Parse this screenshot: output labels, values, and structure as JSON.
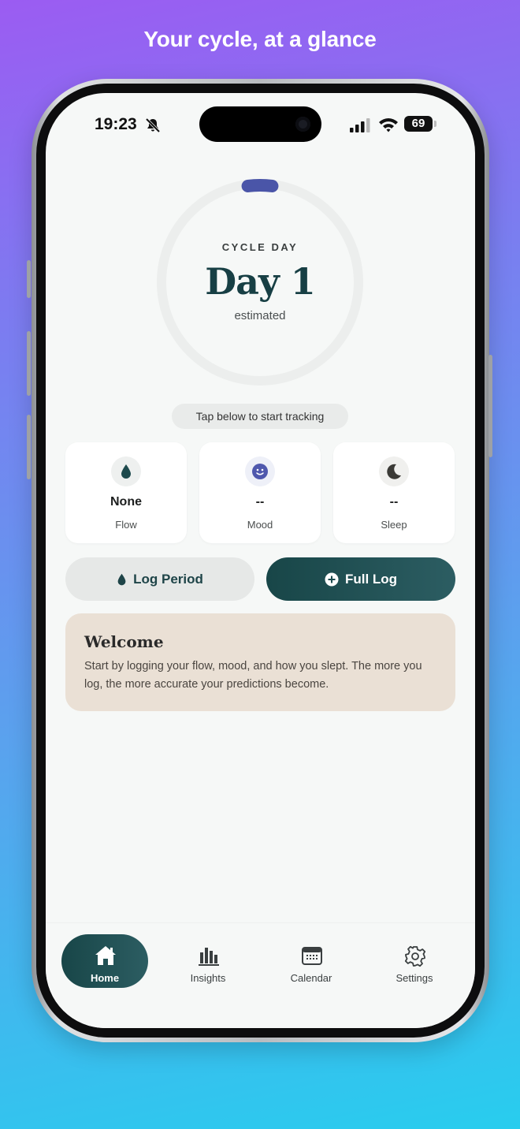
{
  "headline": "Your cycle, at a glance",
  "status_bar": {
    "time": "19:23",
    "battery": "69",
    "icons": [
      "bell-slash-icon",
      "signal-icon",
      "wifi-icon",
      "battery-icon"
    ]
  },
  "cycle": {
    "label": "CYCLE DAY",
    "day": "Day 1",
    "note": "estimated",
    "progress_fraction": 0.04
  },
  "tip": "Tap below to start tracking",
  "stats": [
    {
      "icon": "drop-icon",
      "value": "None",
      "label": "Flow"
    },
    {
      "icon": "smile-icon",
      "value": "--",
      "label": "Mood"
    },
    {
      "icon": "moon-icon",
      "value": "--",
      "label": "Sleep"
    }
  ],
  "actions": {
    "log_period": "Log Period",
    "full_log": "Full Log"
  },
  "welcome": {
    "title": "Welcome",
    "body": "Start by logging your flow, mood, and how you slept. The more you log, the more accurate your predictions become."
  },
  "tabs": [
    {
      "label": "Home",
      "icon": "home-icon",
      "active": true
    },
    {
      "label": "Insights",
      "icon": "bar-chart-icon",
      "active": false
    },
    {
      "label": "Calendar",
      "icon": "calendar-icon",
      "active": false
    },
    {
      "label": "Settings",
      "icon": "gear-icon",
      "active": false
    }
  ],
  "colors": {
    "accent_dark": "#184648",
    "ring_progress": "#4a55a8",
    "welcome_bg": "#eae0d5"
  }
}
